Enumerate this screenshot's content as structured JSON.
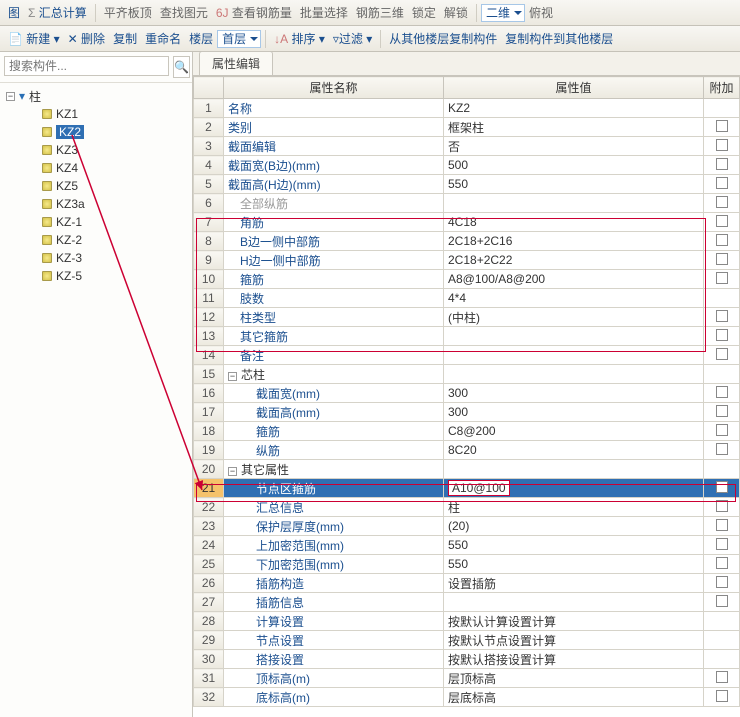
{
  "toolbar1": {
    "view": "图",
    "sumcalc": "汇总计算",
    "flattop": "平齐板顶",
    "findelem": "查找图元",
    "viewrebar": "查看钢筋量",
    "batchsel": "批量选择",
    "rebar3d": "钢筋三维",
    "lock": "锁定",
    "unlock": "解锁",
    "dim2d": "二维",
    "bird": "俯视"
  },
  "toolbar2": {
    "new": "新建",
    "del": "删除",
    "copy": "复制",
    "rename": "重命名",
    "floor": "楼层",
    "floor_sel": "首层",
    "sort": "排序",
    "filter": "过滤",
    "copyfrom": "从其他楼层复制构件",
    "copyto": "复制构件到其他楼层"
  },
  "search": {
    "placeholder": "搜索构件..."
  },
  "tree": {
    "root": "柱",
    "items": [
      "KZ1",
      "KZ2",
      "KZ3",
      "KZ4",
      "KZ5",
      "KZ3a",
      "KZ-1",
      "KZ-2",
      "KZ-3",
      "KZ-5"
    ],
    "selected": "KZ2"
  },
  "tab": {
    "label": "属性编辑"
  },
  "grid": {
    "headers": {
      "name": "属性名称",
      "value": "属性值",
      "extra": "附加"
    },
    "rows": [
      {
        "n": 1,
        "name": "名称",
        "value": "KZ2",
        "link": true
      },
      {
        "n": 2,
        "name": "类别",
        "value": "框架柱",
        "link": true,
        "chk": true
      },
      {
        "n": 3,
        "name": "截面编辑",
        "value": "否",
        "link": true,
        "chk": true
      },
      {
        "n": 4,
        "name": "截面宽(B边)(mm)",
        "value": "500",
        "link": true,
        "chk": true
      },
      {
        "n": 5,
        "name": "截面高(H边)(mm)",
        "value": "550",
        "link": true,
        "chk": true
      },
      {
        "n": 6,
        "name": "全部纵筋",
        "value": "",
        "gray": true,
        "chk": true,
        "indent": 1
      },
      {
        "n": 7,
        "name": "角筋",
        "value": "4C18",
        "link": true,
        "chk": true,
        "indent": 1
      },
      {
        "n": 8,
        "name": "B边一侧中部筋",
        "value": "2C18+2C16",
        "link": true,
        "chk": true,
        "indent": 1
      },
      {
        "n": 9,
        "name": "H边一侧中部筋",
        "value": "2C18+2C22",
        "link": true,
        "chk": true,
        "indent": 1
      },
      {
        "n": 10,
        "name": "箍筋",
        "value": "A8@100/A8@200",
        "link": true,
        "chk": true,
        "indent": 1
      },
      {
        "n": 11,
        "name": "肢数",
        "value": "4*4",
        "link": true,
        "indent": 1
      },
      {
        "n": 12,
        "name": "柱类型",
        "value": "(中柱)",
        "link": true,
        "chk": true,
        "indent": 1
      },
      {
        "n": 13,
        "name": "其它箍筋",
        "value": "",
        "link": true,
        "chk": true,
        "indent": 1
      },
      {
        "n": 14,
        "name": "备注",
        "value": "",
        "link": true,
        "chk": true,
        "indent": 1
      },
      {
        "n": 15,
        "name": "芯柱",
        "value": "",
        "group": true
      },
      {
        "n": 16,
        "name": "截面宽(mm)",
        "value": "300",
        "link": true,
        "chk": true,
        "indent": 2
      },
      {
        "n": 17,
        "name": "截面高(mm)",
        "value": "300",
        "link": true,
        "chk": true,
        "indent": 2
      },
      {
        "n": 18,
        "name": "箍筋",
        "value": "C8@200",
        "link": true,
        "chk": true,
        "indent": 2
      },
      {
        "n": 19,
        "name": "纵筋",
        "value": "8C20",
        "link": true,
        "chk": true,
        "indent": 2
      },
      {
        "n": 20,
        "name": "其它属性",
        "value": "",
        "group": true
      },
      {
        "n": 21,
        "name": "节点区箍筋",
        "value": "A10@100",
        "link": true,
        "chk": true,
        "indent": 2,
        "selected": true
      },
      {
        "n": 22,
        "name": "汇总信息",
        "value": "柱",
        "link": true,
        "chk": true,
        "indent": 2
      },
      {
        "n": 23,
        "name": "保护层厚度(mm)",
        "value": "(20)",
        "link": true,
        "chk": true,
        "indent": 2
      },
      {
        "n": 24,
        "name": "上加密范围(mm)",
        "value": "550",
        "link": true,
        "chk": true,
        "indent": 2
      },
      {
        "n": 25,
        "name": "下加密范围(mm)",
        "value": "550",
        "link": true,
        "chk": true,
        "indent": 2
      },
      {
        "n": 26,
        "name": "插筋构造",
        "value": "设置插筋",
        "link": true,
        "chk": true,
        "indent": 2
      },
      {
        "n": 27,
        "name": "插筋信息",
        "value": "",
        "link": true,
        "chk": true,
        "indent": 2
      },
      {
        "n": 28,
        "name": "计算设置",
        "value": "按默认计算设置计算",
        "link": true,
        "indent": 2
      },
      {
        "n": 29,
        "name": "节点设置",
        "value": "按默认节点设置计算",
        "link": true,
        "indent": 2
      },
      {
        "n": 30,
        "name": "搭接设置",
        "value": "按默认搭接设置计算",
        "link": true,
        "indent": 2
      },
      {
        "n": 31,
        "name": "顶标高(m)",
        "value": "层顶标高",
        "link": true,
        "chk": true,
        "indent": 2
      },
      {
        "n": 32,
        "name": "底标高(m)",
        "value": "层底标高",
        "link": true,
        "chk": true,
        "indent": 2
      }
    ]
  }
}
